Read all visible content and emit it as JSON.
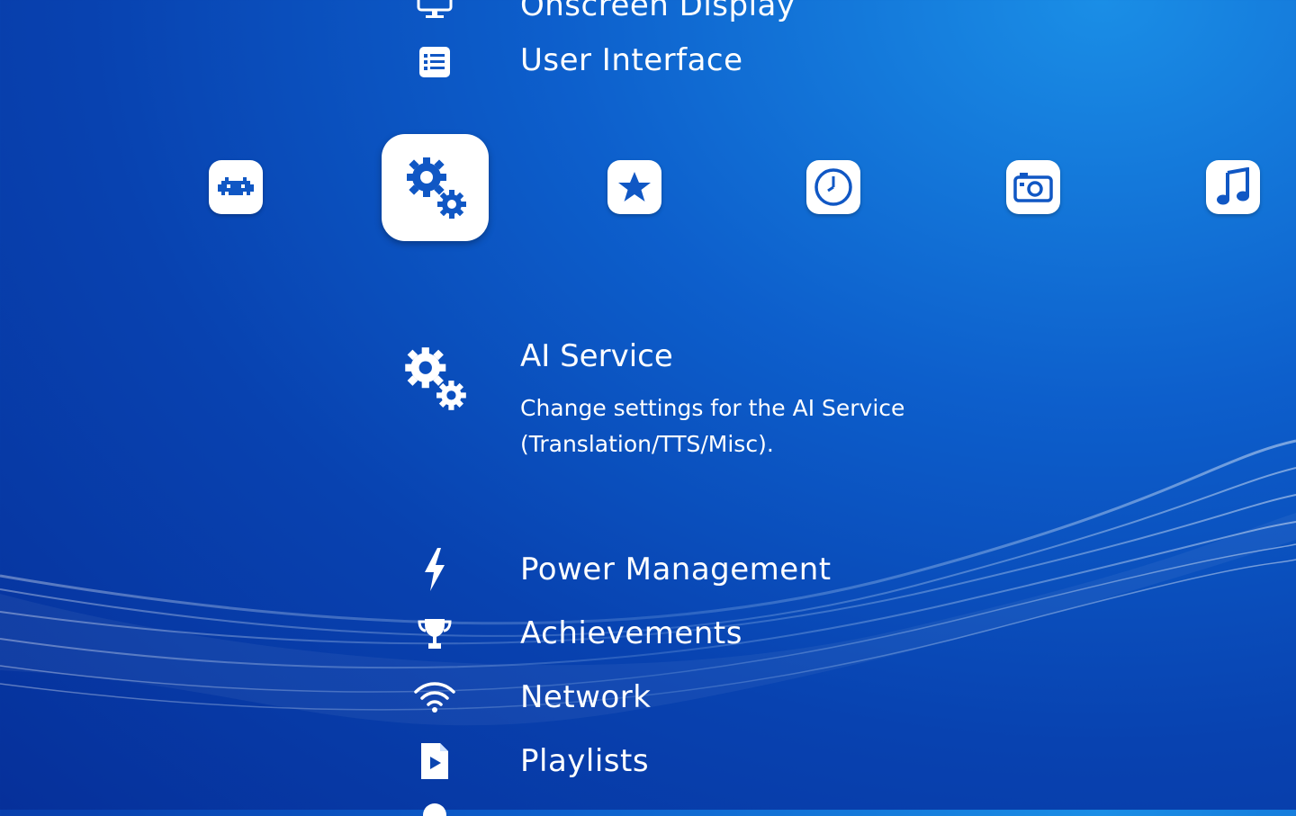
{
  "categories": [
    {
      "name": "retroarch-icon"
    },
    {
      "name": "settings-gears-icon",
      "selected": true
    },
    {
      "name": "favorites-star-icon"
    },
    {
      "name": "history-clock-icon"
    },
    {
      "name": "images-camera-icon"
    },
    {
      "name": "music-note-icon"
    }
  ],
  "menu": {
    "items_above": [
      {
        "label": "Onscreen Display",
        "icon": "monitor-icon"
      },
      {
        "label": "User Interface",
        "icon": "list-icon"
      }
    ],
    "selected": {
      "label": "AI Service",
      "description": "Change settings for the AI Service\n(Translation/TTS/Misc).",
      "icon": "gears-icon"
    },
    "items_below": [
      {
        "label": "Power Management",
        "icon": "lightning-icon"
      },
      {
        "label": "Achievements",
        "icon": "trophy-icon"
      },
      {
        "label": "Network",
        "icon": "wifi-icon"
      },
      {
        "label": "Playlists",
        "icon": "playlist-file-icon"
      }
    ]
  },
  "colors": {
    "background": "#0d5fcc",
    "accent": "#1057c4",
    "text": "#ffffff"
  }
}
